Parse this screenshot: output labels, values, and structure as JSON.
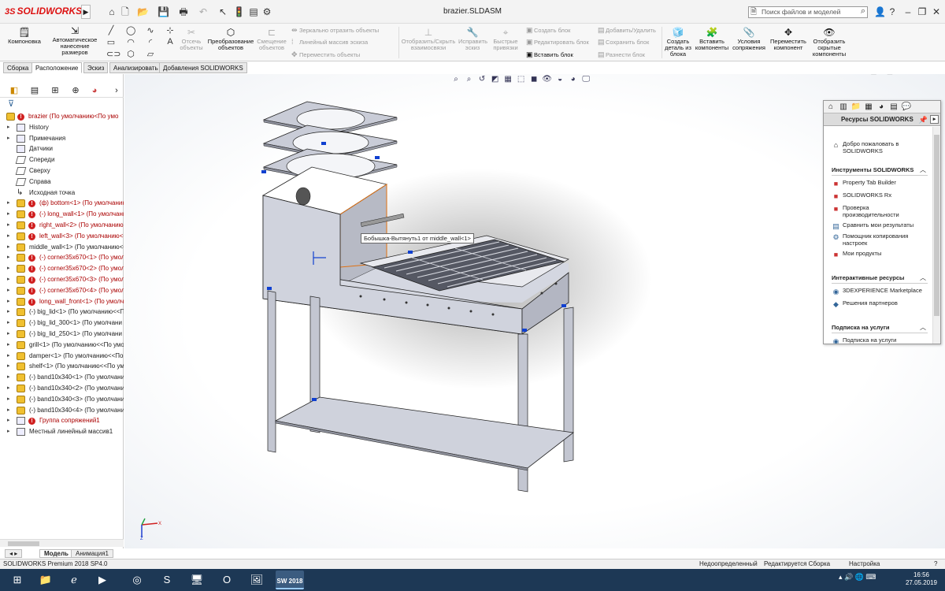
{
  "app": {
    "logo_ds": "3S",
    "logo_text": "SOLIDWORKS",
    "document_title": "brazier.SLDASM"
  },
  "search": {
    "placeholder": "Поиск файлов и моделей"
  },
  "commands": {
    "layout": "Компоновка",
    "auto_dim": "Автоматическое нанесение размеров",
    "trim": "Отсечь объекты",
    "transform": "Преобразование объектов",
    "offset": "Смещение объектов",
    "mirror": "Зеркально отразить объекты",
    "linear_pattern": "Линейный массив эскиза",
    "move_entities": "Переместить объекты",
    "show_hide_relations": "Отобразить/Скрыть взаимосвязи",
    "repair_sketch": "Исправить эскиз",
    "quick_snaps": "Быстрые привязки",
    "make_block": "Создать блок",
    "edit_block": "Редактировать блок",
    "insert_block": "Вставить блок",
    "add_remove": "Добавить/Удалить",
    "save_block": "Сохранить блок",
    "explode_block": "Разнести блок",
    "make_part_from_block": "Создать деталь из блока",
    "insert_components": "Вставить компоненты",
    "mate": "Условия сопряжения",
    "move_component": "Переместить компонент",
    "show_hidden": "Отобразить скрытые компоненты"
  },
  "tabs": [
    "Сборка",
    "Расположение",
    "Эскиз",
    "Анализировать",
    "Добавления SOLIDWORKS"
  ],
  "tree": [
    {
      "label": "brazier  (По умолчанию<По умо",
      "type": "asm",
      "err": true
    },
    {
      "label": "History",
      "type": "folder",
      "err": false
    },
    {
      "label": "Примечания",
      "type": "folder",
      "err": false
    },
    {
      "label": "Датчики",
      "type": "folder",
      "err": false
    },
    {
      "label": "Спереди",
      "type": "plane",
      "err": false
    },
    {
      "label": "Сверху",
      "type": "plane",
      "err": false
    },
    {
      "label": "Справа",
      "type": "plane",
      "err": false
    },
    {
      "label": "Исходная точка",
      "type": "origin",
      "err": false
    },
    {
      "label": "(ф) bottom<1> (По умолчанию",
      "type": "comp",
      "err": true
    },
    {
      "label": "(-) long_wall<1> (По умолчани",
      "type": "comp",
      "err": true
    },
    {
      "label": "right_wall<2> (По умолчанию<<",
      "type": "comp",
      "err": true
    },
    {
      "label": "left_wall<3> (По умолчанию<<",
      "type": "comp",
      "err": true
    },
    {
      "label": "middle_wall<1> (По умолчанию<<",
      "type": "comp",
      "err": false
    },
    {
      "label": "(-) corner35x670<1> (По умолч",
      "type": "comp",
      "err": true
    },
    {
      "label": "(-) corner35x670<2> (По умолч",
      "type": "comp",
      "err": true
    },
    {
      "label": "(-) corner35x670<3> (По умолч",
      "type": "comp",
      "err": true
    },
    {
      "label": "(-) corner35x670<4> (По умолч",
      "type": "comp",
      "err": true
    },
    {
      "label": "long_wall_front<1> (По умолча",
      "type": "comp",
      "err": true
    },
    {
      "label": "(-) big_lid<1> (По умолчанию<<П",
      "type": "comp",
      "err": false
    },
    {
      "label": "(-) big_lid_300<1> (По умолчани",
      "type": "comp",
      "err": false
    },
    {
      "label": "(-) big_lid_250<1> (По умолчани",
      "type": "comp",
      "err": false
    },
    {
      "label": "grill<1> (По умолчанию<<По умо",
      "type": "comp",
      "err": false
    },
    {
      "label": "damper<1> (По умолчанию<<По",
      "type": "comp",
      "err": false
    },
    {
      "label": "shelf<1> (По умолчанию<<По ум",
      "type": "comp",
      "err": false
    },
    {
      "label": "(-) band10x340<1> (По умолчани",
      "type": "comp",
      "err": false
    },
    {
      "label": "(-) band10x340<2> (По умолчани",
      "type": "comp",
      "err": false
    },
    {
      "label": "(-) band10x340<3> (По умолчани",
      "type": "comp",
      "err": false
    },
    {
      "label": "(-) band10x340<4> (По умолчани",
      "type": "comp",
      "err": false
    },
    {
      "label": "Группа сопряжений1",
      "type": "mates",
      "err": true
    },
    {
      "label": "Местный линейный массив1",
      "type": "pattern",
      "err": false
    }
  ],
  "viewport": {
    "tooltip": "Бобышка-Вытянуть1 от middle_wall<1>"
  },
  "taskpane": {
    "title": "Ресурсы SOLIDWORKS",
    "welcome": "Добро пожаловать в SOLIDWORKS",
    "tools_header": "Инструменты SOLIDWORKS",
    "tools": [
      "Property Tab Builder",
      "SOLIDWORKS Rx",
      "Проверка производительности",
      "Сравнить мои результаты",
      "Помощник копирования настроек",
      "Мои продукты"
    ],
    "interactive_header": "Интерактивные ресурсы",
    "interactive": [
      "3DEXPERIENCE Marketplace",
      "Решения партнеров"
    ],
    "subscription_header": "Подписка на услуги",
    "subscription": [
      "Подписка на услуги"
    ]
  },
  "bottom_tabs": [
    "Модель",
    "Анимация1"
  ],
  "status": {
    "product": "SOLIDWORKS Premium 2018 SP4.0",
    "state": "Недоопределенный",
    "editing": "Редактируется Сборка",
    "custom": "Настройка"
  },
  "taskbar": {
    "time": "16:56",
    "date": "27.05.2019",
    "sw_badge": "2018"
  },
  "colors": {
    "error_red": "#d02020",
    "tree_error_text": "#aa0000",
    "taskbar": "#1d3855",
    "model_face": "#d8dbe6"
  }
}
